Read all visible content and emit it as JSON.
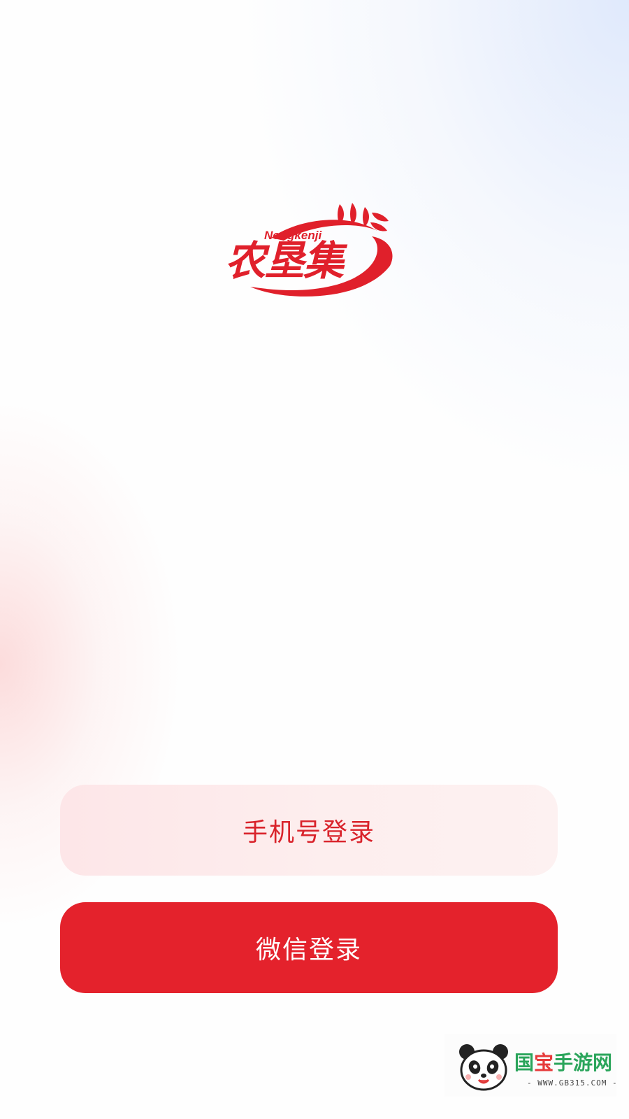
{
  "brand": {
    "name_cn": "农垦集",
    "name_latin": "Nongkenji",
    "color": "#e0202b"
  },
  "login": {
    "phone_button_label": "手机号登录",
    "wechat_button_label": "微信登录",
    "accent_color": "#e4222c"
  },
  "watermark": {
    "title_part1": "国",
    "title_part2": "宝",
    "title_part3": "手游网",
    "url": "- WWW.GB315.COM -",
    "icon": "panda-icon"
  }
}
